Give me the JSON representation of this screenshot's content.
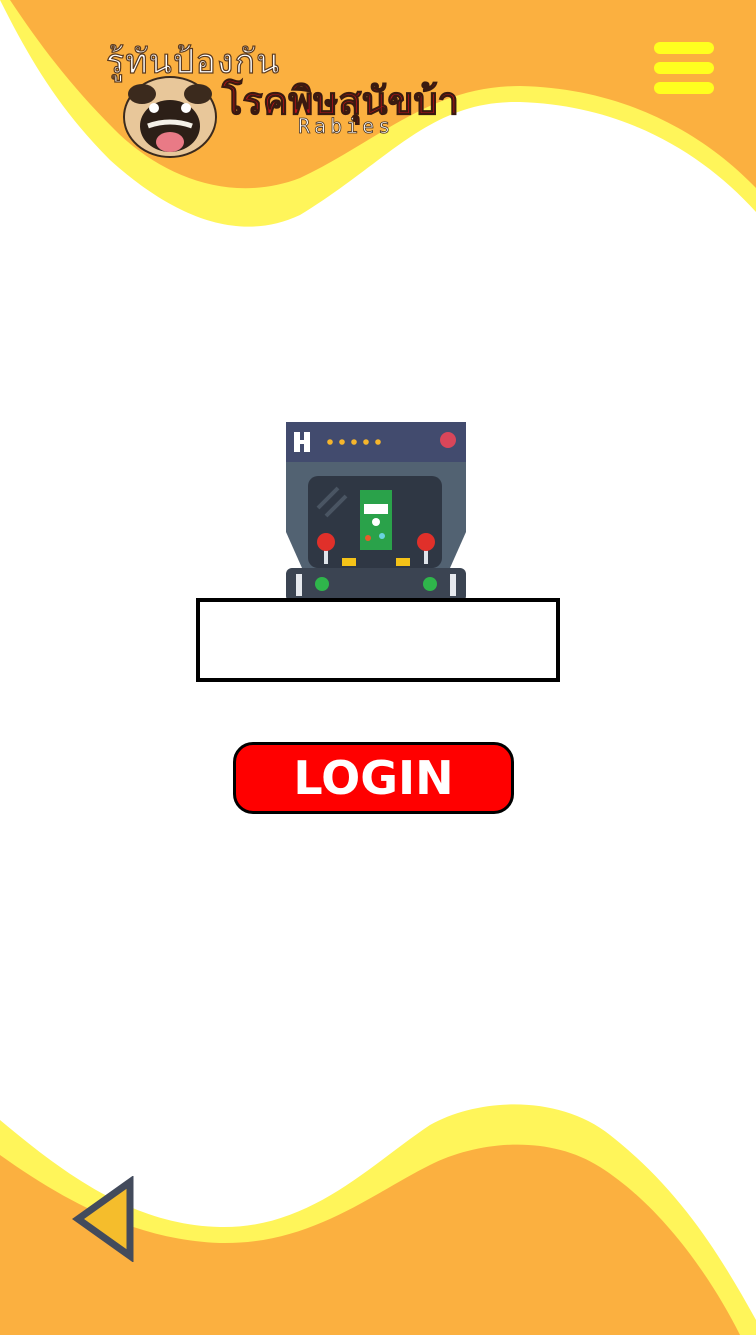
{
  "header": {
    "logo": {
      "line1": "รู้ทันป้องกัน",
      "line2": "โรคพิษสุนัขบ้า",
      "line3": "Rabies"
    },
    "menu_icon": "hamburger-menu-icon"
  },
  "main": {
    "illustration_icon": "arcade-machine-icon",
    "username_field": {
      "value": "",
      "placeholder": ""
    },
    "login_label": "LOGIN"
  },
  "footer": {
    "back_icon": "back-triangle-icon"
  },
  "colors": {
    "wave_orange": "#FBB040",
    "wave_yellow": "#FFF55A",
    "menu_yellow": "#FFFF1F",
    "login_red": "#FF0000",
    "logo_red": "#B5121B",
    "back_outline": "#434B5C",
    "back_fill": "#F5BD2C"
  }
}
